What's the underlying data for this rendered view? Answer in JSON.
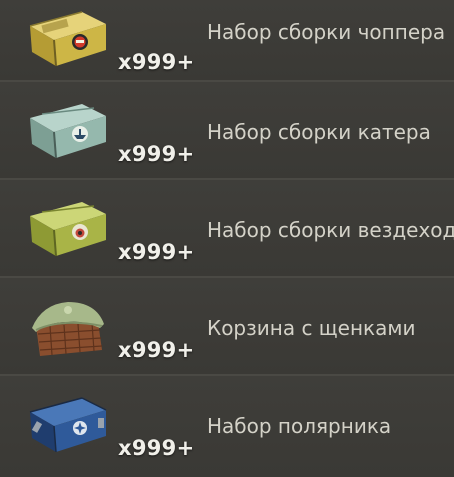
{
  "items": [
    {
      "icon": "chopper-kit-crate-icon",
      "quantity": "x999+",
      "name": "Набор сборки чоппера",
      "color": "#c9b34a"
    },
    {
      "icon": "boat-kit-crate-icon",
      "quantity": "x999+",
      "name": "Набор сборки катера",
      "color": "#8fb3a8"
    },
    {
      "icon": "atv-kit-crate-icon",
      "quantity": "x999+",
      "name": "Набор сборки вездехода",
      "color": "#a8b44a"
    },
    {
      "icon": "puppy-basket-icon",
      "quantity": "x999+",
      "name": "Корзина с щенками",
      "color": "#8a9a6a"
    },
    {
      "icon": "polar-explorer-kit-crate-icon",
      "quantity": "x999+",
      "name": "Набор полярника",
      "color": "#2f5a9a"
    }
  ]
}
